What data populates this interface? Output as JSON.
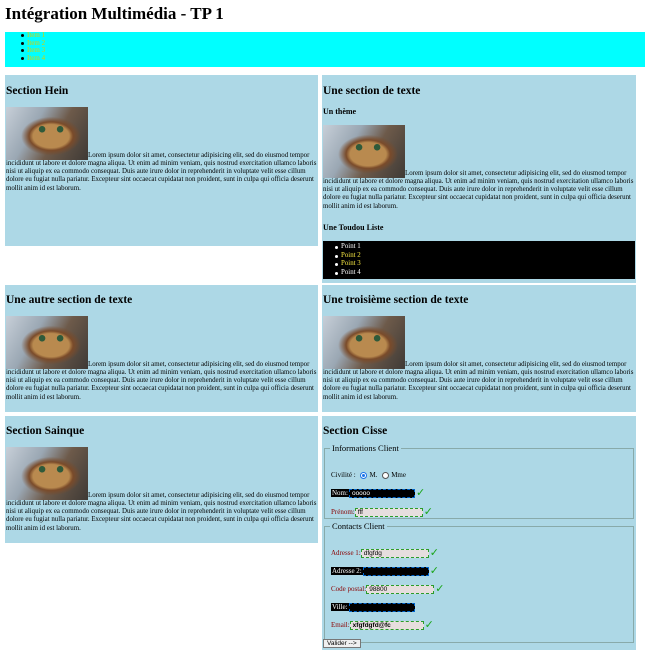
{
  "page": {
    "title": "Intégration Multimédia - TP 1"
  },
  "nav": {
    "items": [
      "Item 1",
      "Item 2",
      "Item 3",
      "Item 4"
    ]
  },
  "lorem": "Lorem ipsum dolor sit amet, consectetur adipisicing elit, sed do eiusmod tempor incididunt ut labore et dolore magna aliqua. Ut enim ad minim veniam, quis nostrud exercitation ullamco laboris nisi ut aliquip ex ea commodo consequat. Duis aute irure dolor in reprehenderit in voluptate velit esse cillum dolore eu fugiat nulla pariatur. Excepteur sint occaecat cupidatat non proident, sunt in culpa qui officia deserunt mollit anim id est laborum.",
  "sections": {
    "hein": {
      "title": "Section Hein"
    },
    "texte": {
      "title": "Une section de texte",
      "subtitle": "Un thème",
      "list_title": "Une Toudou Liste",
      "list": [
        "Point 1",
        "Point 2",
        "Point 3",
        "Point 4"
      ],
      "list_colors": [
        "#ffffff",
        "#f5e642",
        "#f5e642",
        "#ffffff"
      ]
    },
    "autre": {
      "title": "Une autre section de texte"
    },
    "troisieme": {
      "title": "Une troisième section de texte"
    },
    "sainque": {
      "title": "Section Sainque"
    },
    "cisse": {
      "title": "Section Cisse",
      "client_legend": "Informations Client",
      "civilite_label": "Civilité :",
      "civilite_options": [
        "M.",
        "Mme"
      ],
      "civilite_selected": "M.",
      "nom_label": "Nom:",
      "nom_value": "ooooo",
      "prenom_label": "Prénom:",
      "prenom_value": "fff",
      "contacts_legend": "Contacts Client",
      "adresse1_label": "Adresse 1:",
      "adresse1_value": "dfgfdg",
      "adresse2_label": "Adresse 2:",
      "adresse2_value": "",
      "cp_label": "Code postal:",
      "cp_value": "98800",
      "ville_label": "Ville:",
      "ville_value": "",
      "email_label": "Email:",
      "email_value": "xfgfdgfd@fc",
      "submit_label": "Valider -->"
    }
  },
  "colors": {
    "section_bg": "#add8e6",
    "nav_bg": "#00ffff",
    "valid_check": "#1aa51a"
  }
}
